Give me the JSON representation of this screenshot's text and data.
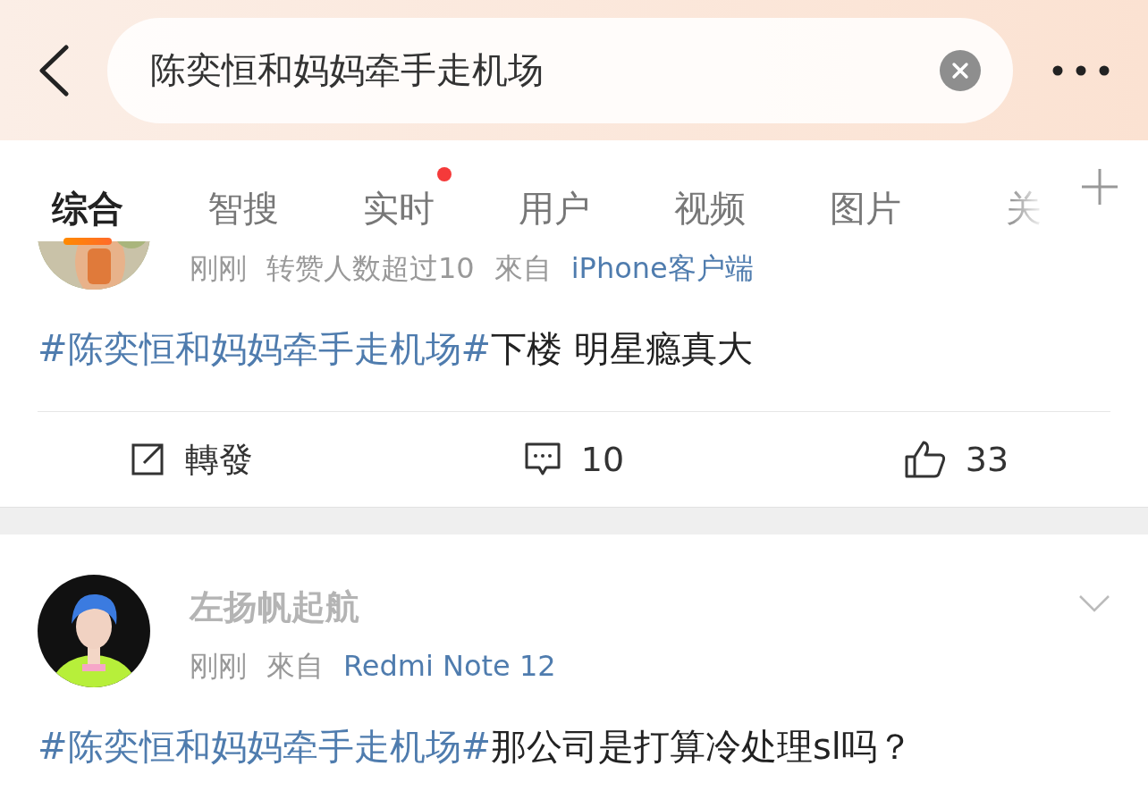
{
  "search": {
    "value": "陈奕恒和妈妈牵手走机场"
  },
  "tabs": [
    {
      "label": "综合",
      "selected": true,
      "dot": false,
      "faded": false
    },
    {
      "label": "智搜",
      "selected": false,
      "dot": false,
      "faded": false
    },
    {
      "label": "实时",
      "selected": false,
      "dot": true,
      "faded": false
    },
    {
      "label": "用户",
      "selected": false,
      "dot": false,
      "faded": false
    },
    {
      "label": "视频",
      "selected": false,
      "dot": false,
      "faded": false
    },
    {
      "label": "图片",
      "selected": false,
      "dot": false,
      "faded": false
    },
    {
      "label": "关",
      "selected": false,
      "dot": false,
      "faded": true
    }
  ],
  "posts": [
    {
      "avatar": {
        "kind": "picture"
      },
      "cropped": true,
      "meta": [
        {
          "text": "刚刚",
          "kind": "plain"
        },
        {
          "text": "转赞人数超过10",
          "kind": "plain"
        },
        {
          "text": "來自",
          "kind": "plain"
        },
        {
          "text": "iPhone客户端",
          "kind": "link"
        }
      ],
      "body": {
        "hashtag": "#陈奕恒和妈妈牵手走机场#",
        "text": "下楼 明星瘾真大"
      },
      "actions": {
        "repost": "轉發",
        "comments": "10",
        "likes": "33"
      }
    },
    {
      "avatar": {
        "kind": "picture"
      },
      "cropped": false,
      "has_menu": true,
      "username": "左扬帆起航",
      "meta": [
        {
          "text": "刚刚",
          "kind": "plain"
        },
        {
          "text": "來自",
          "kind": "plain"
        },
        {
          "text": "Redmi Note 12",
          "kind": "link"
        }
      ],
      "body": {
        "hashtag": "#陈奕恒和妈妈牵手走机场#",
        "text": "那公司是打算冷处理sl吗？"
      }
    }
  ]
}
